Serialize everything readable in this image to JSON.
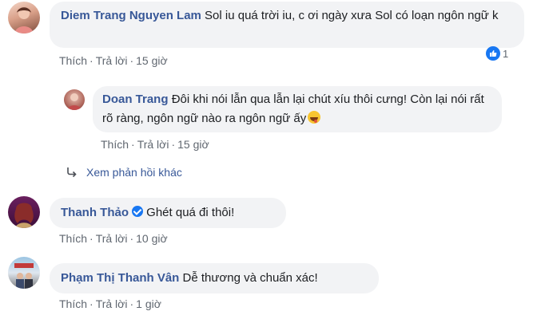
{
  "comments": [
    {
      "author": "Diem Trang Nguyen Lam",
      "text": "Sol iu quá trời iu, c ơi ngày xưa Sol có loạn ngôn ngữ k",
      "actions": {
        "like": "Thích",
        "reply": "Trả lời",
        "time": "15 giờ"
      },
      "reaction_count": "1"
    },
    {
      "author": "Doan Trang",
      "text": "Đôi khi nói lẫn qua lẫn lại chút xíu thôi cưng! Còn lại nói rất rõ ràng, ngôn ngữ nào ra ngôn ngữ ấy",
      "actions": {
        "like": "Thích",
        "reply": "Trả lời",
        "time": "15 giờ"
      }
    },
    {
      "author": "Thanh Thảo",
      "text": "Ghét quá đi thôi!",
      "actions": {
        "like": "Thích",
        "reply": "Trả lời",
        "time": "10 giờ"
      }
    },
    {
      "author": "Phạm Thị Thanh Vân",
      "text": "Dễ thương và chuẩn xác!",
      "actions": {
        "like": "Thích",
        "reply": "Trả lời",
        "time": "1 giờ"
      }
    }
  ],
  "more_replies_label": "Xem phản hồi khác",
  "colors": {
    "author": "#385898",
    "bubble": "#f2f3f5",
    "meta": "#606770",
    "like": "#1877f2"
  },
  "icons": {
    "reaction": "like-icon",
    "reply_arrow": "reply-arrow-icon",
    "verified": "verified-badge-icon",
    "emoji": "tongue-emoji-icon"
  }
}
